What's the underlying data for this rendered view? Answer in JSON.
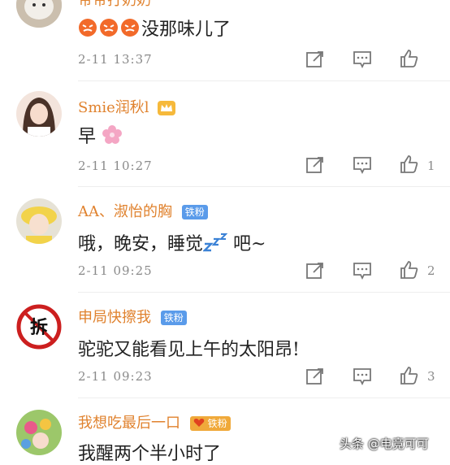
{
  "comments": [
    {
      "username": "帝帝打奶奶",
      "text": "没那味儿了",
      "time": "2-11 13:37",
      "likes": ""
    },
    {
      "username": "Smie润秋l",
      "text": "早",
      "time": "2-11 10:27",
      "likes": "1"
    },
    {
      "username": "AA、淑怡的胸",
      "badge": "铁粉",
      "text_before": "哦，晚安，睡觉",
      "text_after": "吧~",
      "time": "2-11 09:25",
      "likes": "2"
    },
    {
      "username": "申局快擦我",
      "badge": "铁粉",
      "text": "驼驼又能看见上午的太阳昂!",
      "time": "2-11 09:23",
      "likes": "3"
    },
    {
      "username": "我想吃最后一口",
      "badge": "铁粉",
      "text": "我醒两个半小时了",
      "time": "",
      "likes": ""
    }
  ],
  "watermark": "头条 @电竞可可",
  "colors": {
    "username": "#e0822e",
    "fan_badge": "#5a9bea",
    "meta": "#8a8a8a"
  }
}
